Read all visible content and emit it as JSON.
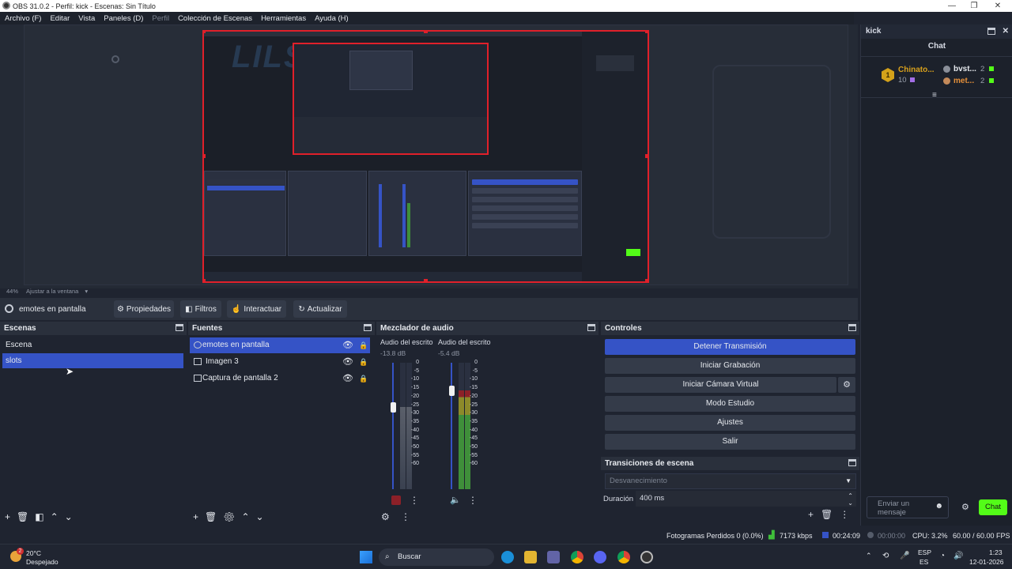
{
  "window": {
    "title": "OBS 31.0.2 - Perfil: kick - Escenas: Sin Título",
    "controls": {
      "minimize": "—",
      "maximize": "❐",
      "close": "✕"
    }
  },
  "menu": [
    "Archivo (F)",
    "Editar",
    "Vista",
    "Paneles (D)",
    "Perfil",
    "Colección de Escenas",
    "Herramientas",
    "Ayuda (H)"
  ],
  "preview": {
    "zoom": "44%",
    "zoom_mode": "Ajustar a la ventana",
    "watermark": "LILSLOTS"
  },
  "source_toolbar": {
    "selected_source": "emotes en pantalla",
    "buttons": {
      "properties": "Propiedades",
      "filters": "Filtros",
      "interact": "Interactuar",
      "refresh": "Actualizar"
    }
  },
  "scenes": {
    "title": "Escenas",
    "items": [
      {
        "label": "Escena",
        "selected": false
      },
      {
        "label": "slots",
        "selected": true
      }
    ]
  },
  "sources": {
    "title": "Fuentes",
    "items": [
      {
        "label": "emotes en pantalla",
        "selected": true,
        "icon": "browser-icon"
      },
      {
        "label": "Imagen 3",
        "selected": false,
        "icon": "image-icon"
      },
      {
        "label": "Captura de pantalla 2",
        "selected": false,
        "icon": "display-capture-icon"
      }
    ]
  },
  "mixer": {
    "title": "Mezclador de audio",
    "channels": [
      {
        "name": "Audio del escrito",
        "db": "-13.8 dB",
        "level": 0.65
      },
      {
        "name": "Audio del escrito",
        "db": "-5.4 dB",
        "level": 0.78
      }
    ],
    "scale": [
      "0",
      "-5",
      "-10",
      "-15",
      "-20",
      "-25",
      "-30",
      "-35",
      "-40",
      "-45",
      "-50",
      "-55",
      "-60"
    ]
  },
  "controls": {
    "title": "Controles",
    "buttons": {
      "stop_stream": "Detener Transmisión",
      "start_rec": "Iniciar Grabación",
      "virtual_cam": "Iniciar Cámara Virtual",
      "studio": "Modo Estudio",
      "settings": "Ajustes",
      "exit": "Salir"
    }
  },
  "transitions": {
    "title": "Transiciones de escena",
    "selected": "Desvanecimiento",
    "duration_label": "Duración",
    "duration_value": "400 ms"
  },
  "chat": {
    "window_title": "kick",
    "header": "Chat",
    "leaders": [
      {
        "rank": "1",
        "name": "Chinato...",
        "amount": "10"
      },
      {
        "name": "bvst...",
        "amount": "2"
      },
      {
        "name": "met...",
        "amount": "2"
      }
    ],
    "input_placeholder": "Enviar un mensaje",
    "send_label": "Chat"
  },
  "status": {
    "dropped_frames": "Fotogramas Perdidos 0 (0.0%)",
    "bitrate": "7173 kbps",
    "stream_time": "00:24:09",
    "rec_time": "00:00:00",
    "cpu": "CPU: 3.2%",
    "fps": "60.00 / 60.00 FPS"
  },
  "taskbar": {
    "weather_temp": "20°C",
    "weather_desc": "Despejado",
    "weather_badge": "2",
    "search_placeholder": "Buscar",
    "lang": "ESP",
    "region": "ES",
    "time": "1:23",
    "date": "12-01-2026"
  },
  "colors": {
    "accent": "#3553c6",
    "live_red": "#e0202a",
    "kick_green": "#53fc18"
  }
}
